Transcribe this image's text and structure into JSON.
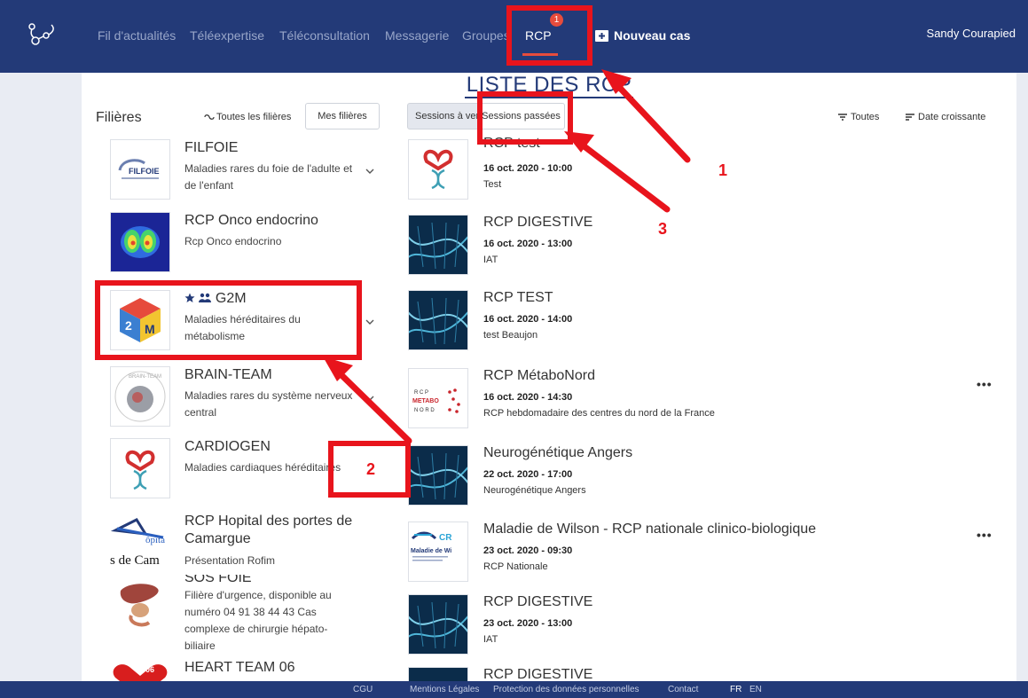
{
  "nav": {
    "items": [
      "Fil d'actualités",
      "Téléexpertise",
      "Téléconsultation",
      "Messagerie",
      "Groupes"
    ],
    "active": "RCP",
    "badge": "1",
    "new_case": "Nouveau cas",
    "user": "Sandy Courapied"
  },
  "page_title": "LISTE DES RCP",
  "filieres": {
    "heading": "Filières",
    "all_link": "Toutes les filières",
    "mine_button": "Mes filières",
    "items": [
      {
        "title": "FILFOIE",
        "desc": "Maladies rares du foie de l'adulte et de l'enfant",
        "logo_text": "FILFOIE"
      },
      {
        "title": "RCP Onco endocrino",
        "desc": "Rcp Onco endocrino"
      },
      {
        "title": "G2M",
        "desc": "Maladies héréditaires du métabolisme"
      },
      {
        "title": "BRAIN-TEAM",
        "desc": "Maladies rares du système nerveux central",
        "logo_text": "BRAIN-TEAM"
      },
      {
        "title": "CARDIOGEN",
        "desc": "Maladies cardiaques héréditaires"
      },
      {
        "title": "RCP Hopital des portes de Camargue",
        "desc": "Présentation Rofim",
        "logo_text": "s de Cam",
        "logo_text2": "ôpita"
      },
      {
        "title": "SOS FOIE",
        "desc": "Filière d'urgence, disponible au numéro 04 91 38 44 43 Cas complexe de chirurgie hépato-biliaire"
      },
      {
        "title": "HEART TEAM 06",
        "logo_text": "06"
      }
    ]
  },
  "sessions": {
    "tab_upcoming": "Sessions à venir",
    "tab_past": "Sessions passées",
    "filter_all": "Toutes",
    "sort_label": "Date croissante",
    "more_label": "•••",
    "items": [
      {
        "title": "RCP test",
        "date": "16 oct. 2020 - 10:00",
        "sub": "Test"
      },
      {
        "title": "RCP DIGESTIVE",
        "date": "16 oct. 2020 - 13:00",
        "sub": "IAT"
      },
      {
        "title": "RCP TEST",
        "date": "16 oct. 2020 - 14:00",
        "sub": "test Beaujon"
      },
      {
        "title": "RCP MétaboNord",
        "date": "16 oct. 2020 - 14:30",
        "sub": "RCP hebdomadaire des centres du nord de la France",
        "logo_lines": [
          "R C P",
          "METABO",
          "N O R D"
        ]
      },
      {
        "title": "Neurogénétique Angers",
        "date": "22 oct. 2020 - 17:00",
        "sub": "Neurogénétique Angers"
      },
      {
        "title": "Maladie de Wilson - RCP nationale clinico-biologique",
        "date": "23 oct. 2020 - 09:30",
        "sub": "RCP Nationale",
        "logo_lines": [
          "CR",
          "Maladie de Wi"
        ]
      },
      {
        "title": "RCP DIGESTIVE",
        "date": "23 oct. 2020 - 13:00",
        "sub": "IAT"
      },
      {
        "title": "RCP DIGESTIVE"
      }
    ]
  },
  "footer": {
    "links": [
      "CGU",
      "Mentions Légales",
      "Protection des données personnelles",
      "Contact"
    ],
    "lang": [
      "FR",
      "EN"
    ]
  },
  "annotations": [
    "1",
    "2",
    "3"
  ],
  "colors": {
    "navbar": "#233a78",
    "accent": "#e74c3c",
    "annotation": "#e8141c",
    "background": "#e9ecf3"
  }
}
